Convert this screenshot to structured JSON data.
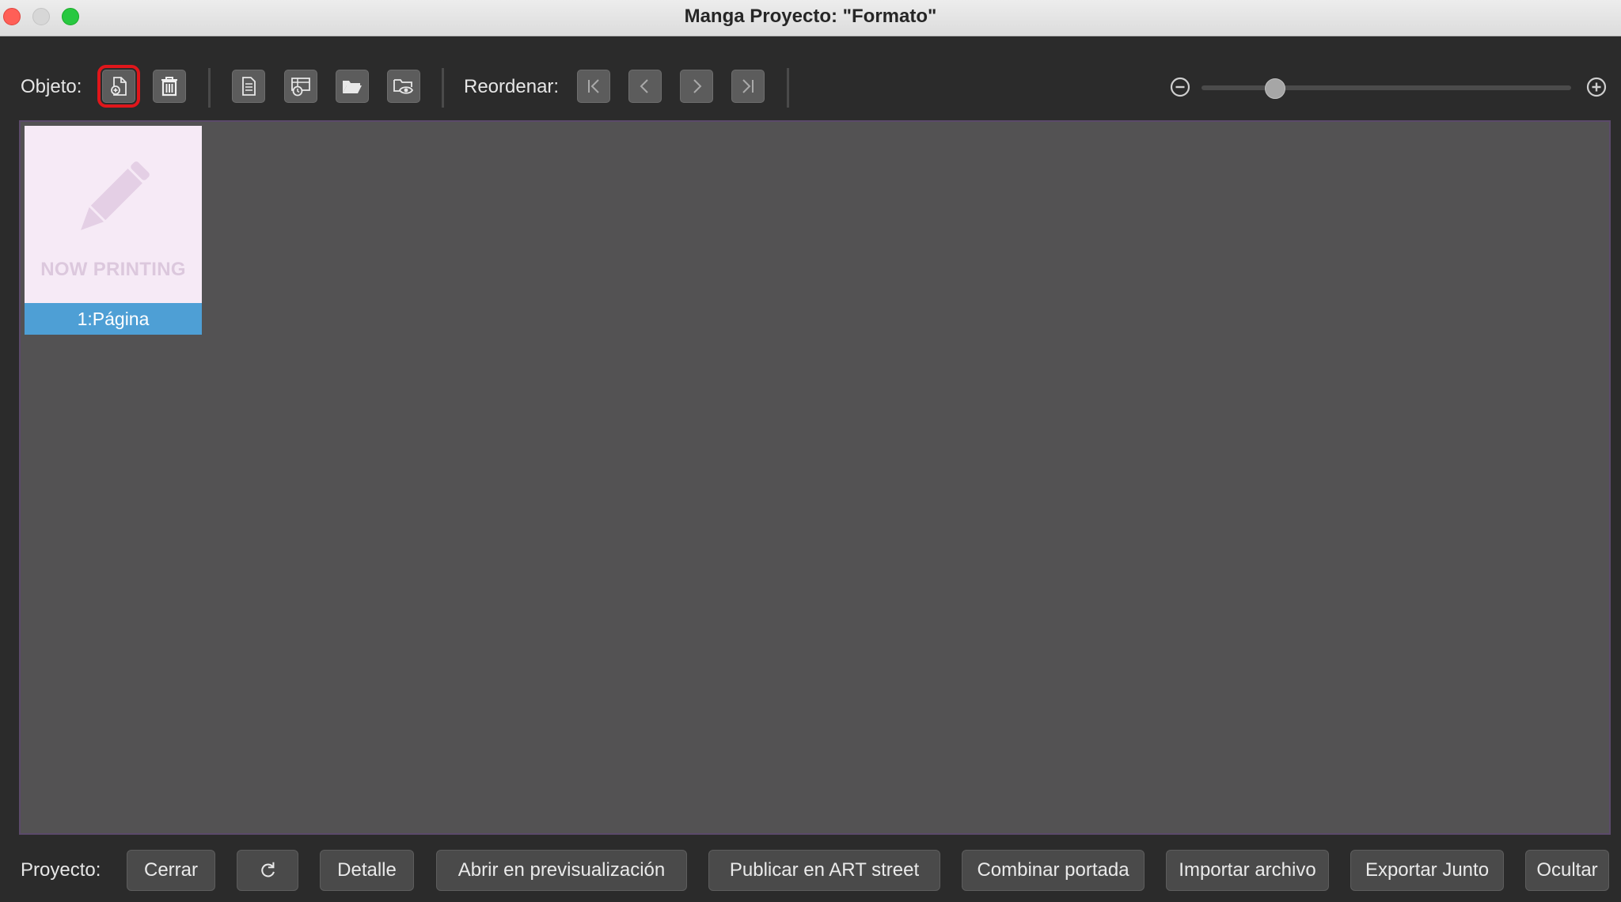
{
  "window": {
    "title": "Manga Proyecto: \"Formato\""
  },
  "toolbar": {
    "object_label": "Objeto:",
    "reorder_label": "Reordenar:",
    "zoom_level": 0.2
  },
  "pages": [
    {
      "thumbnail_text": "NOW PRINTING",
      "label": "1:Página"
    }
  ],
  "footer": {
    "project_label": "Proyecto:",
    "buttons": {
      "close": "Cerrar",
      "detail": "Detalle",
      "preview": "Abrir en previsualización",
      "publish": "Publicar en ART street",
      "combine_cover": "Combinar portada",
      "import_file": "Importar archivo",
      "export_together": "Exportar Junto",
      "hide": "Ocultar"
    }
  },
  "colors": {
    "accent_selection": "#4e9fd5",
    "highlight_box": "#e0161b",
    "canvas_bg": "#535253",
    "thumbnail_bg": "#f6eaf6"
  },
  "icons": [
    "add-page-icon",
    "trash-icon",
    "page-settings-icon",
    "page-timer-icon",
    "folder-open-icon",
    "folder-preview-icon",
    "first-icon",
    "previous-icon",
    "next-icon",
    "last-icon",
    "zoom-out-icon",
    "zoom-in-icon",
    "refresh-icon",
    "pencil-icon"
  ]
}
